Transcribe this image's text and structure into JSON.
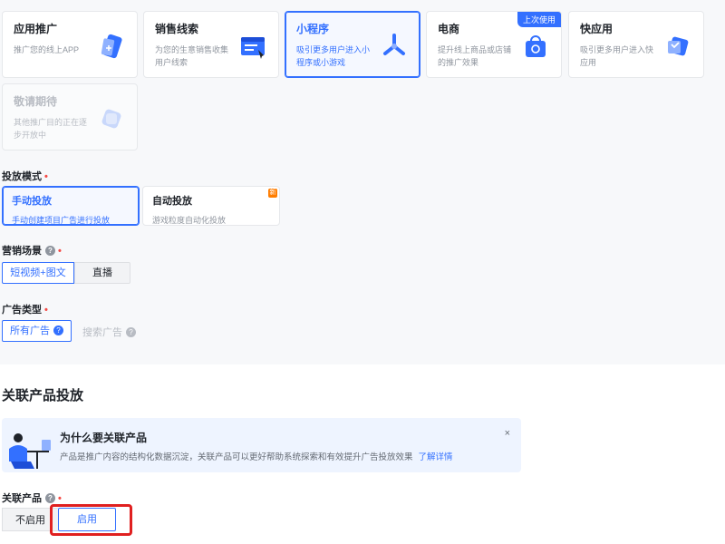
{
  "cards": [
    {
      "title": "应用推广",
      "desc": "推广您的线上APP",
      "icon": "app-promo-icon",
      "state": "normal"
    },
    {
      "title": "销售线索",
      "desc": "为您的生意销售收集用户线索",
      "icon": "sales-lead-icon",
      "state": "normal"
    },
    {
      "title": "小程序",
      "desc": "吸引更多用户进入小程序或小游戏",
      "icon": "mini-program-icon",
      "state": "selected"
    },
    {
      "title": "电商",
      "desc": "提升线上商品或店铺的推广效果",
      "icon": "ecommerce-icon",
      "state": "normal",
      "badge": "上次使用"
    },
    {
      "title": "快应用",
      "desc": "吸引更多用户进入快应用",
      "icon": "quick-app-icon",
      "state": "normal"
    },
    {
      "title": "敬请期待",
      "desc": "其他推广目的正在逐步开放中",
      "icon": "coming-soon-icon",
      "state": "disabled"
    }
  ],
  "delivery_mode": {
    "label": "投放模式",
    "required_mark": "•",
    "options": [
      {
        "title": "手动投放",
        "desc": "手动创建项目广告进行投放",
        "selected": true
      },
      {
        "title": "自动投放",
        "desc": "游戏粒度自动化投放",
        "selected": false,
        "corner_tag": "新"
      }
    ]
  },
  "scene": {
    "label": "营销场景",
    "help": "?",
    "required_mark": "•",
    "options": [
      "短视频+图文",
      "直播"
    ]
  },
  "ad_type": {
    "label": "广告类型",
    "required_mark": "•",
    "selected": "所有广告",
    "other": "搜索广告",
    "help": "?"
  },
  "product": {
    "section_title": "关联产品投放",
    "info_title": "为什么要关联产品",
    "info_text": "产品是推广内容的结构化数据沉淀，关联产品可以更好帮助系统探索和有效提升广告投放效果",
    "info_link": "了解详情",
    "close": "×",
    "label": "关联产品",
    "help": "?",
    "required_mark": "•",
    "off": "不启用",
    "on": "启用"
  },
  "colors": {
    "accent": "#3370ff",
    "highlight": "#e02020"
  }
}
